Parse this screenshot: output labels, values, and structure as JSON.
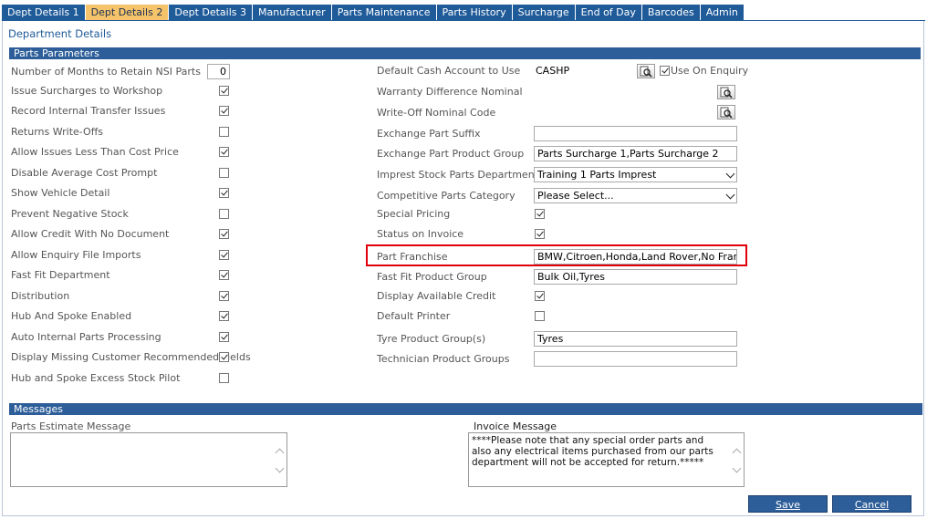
{
  "tabs": [
    {
      "label": "Dept Details 1",
      "active": false
    },
    {
      "label": "Dept Details 2",
      "active": true
    },
    {
      "label": "Dept Details 3",
      "active": false
    },
    {
      "label": "Manufacturer",
      "active": false
    },
    {
      "label": "Parts Maintenance",
      "active": false
    },
    {
      "label": "Parts History",
      "active": false
    },
    {
      "label": "Surcharge",
      "active": false
    },
    {
      "label": "End of Day",
      "active": false
    },
    {
      "label": "Barcodes",
      "active": false
    },
    {
      "label": "Admin",
      "active": false
    }
  ],
  "page_title": "Department Details",
  "parts_parameters": {
    "header": "Parts Parameters",
    "left": {
      "months_label": "Number of Months to Retain NSI Parts",
      "months_value": "0",
      "checkboxes": [
        {
          "label": "Issue Surcharges to Workshop",
          "checked": true
        },
        {
          "label": "Record Internal Transfer Issues",
          "checked": true
        },
        {
          "label": "Returns Write-Offs",
          "checked": false
        },
        {
          "label": "Allow Issues Less Than Cost Price",
          "checked": true
        },
        {
          "label": "Disable Average Cost Prompt",
          "checked": false
        },
        {
          "label": "Show Vehicle Detail",
          "checked": true
        },
        {
          "label": "Prevent Negative Stock",
          "checked": false
        },
        {
          "label": "Allow Credit With No Document",
          "checked": true
        },
        {
          "label": "Allow Enquiry File Imports",
          "checked": true
        },
        {
          "label": "Fast Fit Department",
          "checked": true
        },
        {
          "label": "Distribution",
          "checked": true
        },
        {
          "label": "Hub And Spoke Enabled",
          "checked": true
        },
        {
          "label": "Auto Internal Parts Processing",
          "checked": true
        },
        {
          "label": "Display Missing Customer Recommended Fields",
          "checked": true
        },
        {
          "label": "Hub and Spoke Excess Stock Pilot",
          "checked": false
        }
      ]
    },
    "right": {
      "default_cash_label": "Default Cash Account to Use",
      "default_cash_value": "CASHP",
      "use_on_enquiry_label": "Use On Enquiry",
      "use_on_enquiry_checked": true,
      "warranty_label": "Warranty Difference Nominal",
      "writeoff_label": "Write-Off Nominal Code",
      "exchange_suffix_label": "Exchange Part Suffix",
      "exchange_suffix_value": "",
      "exchange_group_label": "Exchange Part Product Group",
      "exchange_group_value": "Parts Surcharge 1,Parts Surcharge 2",
      "imprest_label": "Imprest Stock Parts Department",
      "imprest_value": "Training 1 Parts Imprest",
      "competitive_label": "Competitive Parts Category",
      "competitive_value": "Please Select...",
      "special_pricing_label": "Special Pricing",
      "special_pricing_checked": true,
      "status_invoice_label": "Status on Invoice",
      "status_invoice_checked": true,
      "franchise_label": "Part Franchise",
      "franchise_value": "BMW,Citroen,Honda,Land Rover,No Franchis...",
      "fastfit_group_label": "Fast Fit Product Group",
      "fastfit_group_value": "Bulk Oil,Tyres",
      "available_credit_label": "Display Available Credit",
      "available_credit_checked": true,
      "default_printer_label": "Default Printer",
      "default_printer_checked": false,
      "tyre_group_label": "Tyre Product Group(s)",
      "tyre_group_value": "Tyres",
      "technician_label": "Technician Product Groups",
      "technician_value": ""
    }
  },
  "messages": {
    "header": "Messages",
    "estimate_label": "Parts Estimate Message",
    "estimate_value": "",
    "invoice_label": "Invoice Message",
    "invoice_value": "****Please note that any special order parts and also any electrical items purchased from our parts department will not be accepted for return.*****"
  },
  "buttons": {
    "save": "Save",
    "cancel": "Cancel"
  },
  "icons": {
    "lookup": "lookup-magnifier-icon",
    "checkmark": "checkmark-icon",
    "dropdown": "chevron-down-icon"
  },
  "colors": {
    "tab_bg": "#1f5a99",
    "tab_active_bg": "#f5c46a",
    "section_bar": "#2d5e99",
    "highlight": "#e0000b"
  }
}
